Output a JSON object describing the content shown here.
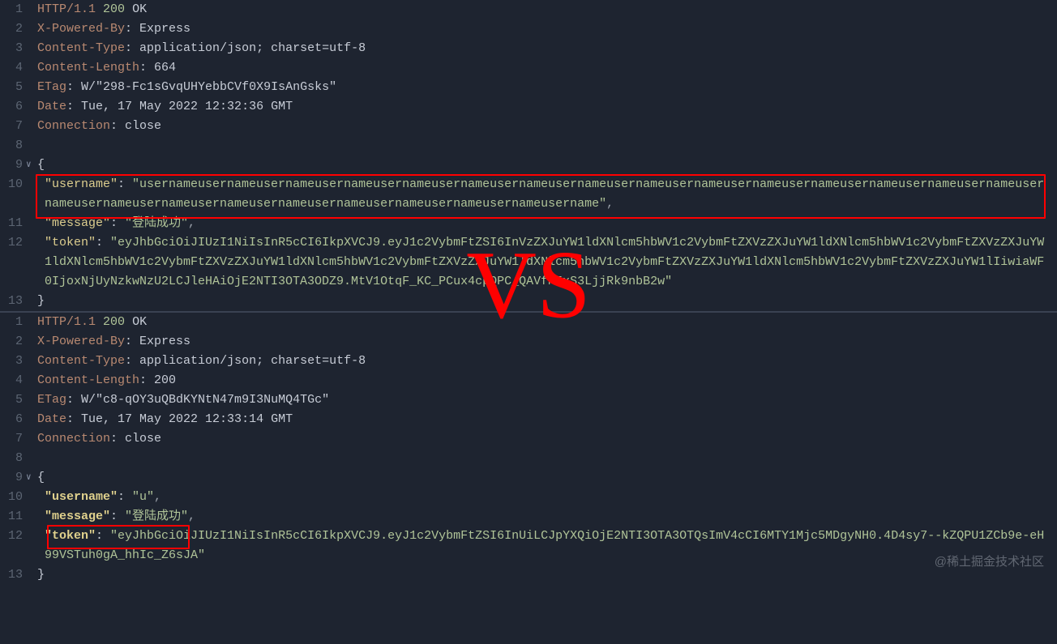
{
  "top": {
    "lines": [
      {
        "n": 1,
        "fold": "",
        "html": [
          [
            "hdr",
            "HTTP/1.1"
          ],
          [
            "sp",
            " "
          ],
          [
            "num",
            "200"
          ],
          [
            "sp",
            " "
          ],
          [
            "val",
            "OK"
          ]
        ]
      },
      {
        "n": 2,
        "fold": "",
        "html": [
          [
            "hdr",
            "X-Powered-By"
          ],
          [
            "colon",
            ": "
          ],
          [
            "val",
            "Express"
          ]
        ]
      },
      {
        "n": 3,
        "fold": "",
        "html": [
          [
            "hdr",
            "Content-Type"
          ],
          [
            "colon",
            ": "
          ],
          [
            "val",
            "application/json; charset=utf-8"
          ]
        ]
      },
      {
        "n": 4,
        "fold": "",
        "html": [
          [
            "hdr",
            "Content-Length"
          ],
          [
            "colon",
            ": "
          ],
          [
            "val",
            "664"
          ]
        ]
      },
      {
        "n": 5,
        "fold": "",
        "html": [
          [
            "hdr",
            "ETag"
          ],
          [
            "colon",
            ": "
          ],
          [
            "val",
            "W/\"298-Fc1sGvqUHYebbCVf0X9IsAnGsks\""
          ]
        ]
      },
      {
        "n": 6,
        "fold": "",
        "html": [
          [
            "hdr",
            "Date"
          ],
          [
            "colon",
            ": "
          ],
          [
            "val",
            "Tue, 17 May 2022 12:32:36 GMT"
          ]
        ]
      },
      {
        "n": 7,
        "fold": "",
        "html": [
          [
            "hdr",
            "Connection"
          ],
          [
            "colon",
            ": "
          ],
          [
            "val",
            "close"
          ]
        ]
      },
      {
        "n": 8,
        "fold": "",
        "html": [
          [
            "val",
            ""
          ]
        ]
      },
      {
        "n": 9,
        "fold": "v",
        "html": [
          [
            "punc",
            "{"
          ]
        ]
      },
      {
        "n": 10,
        "fold": "",
        "indent": 1,
        "html": [
          [
            "key",
            "\"username\""
          ],
          [
            "colon",
            ": "
          ],
          [
            "str",
            "\"usernameusernameusernameusernameusernameusernameusernameusernameusernameusernameusernameusernameusernameusernameusernameusernameusernameusernameusernameusernameusernameusernameusernameusernameusername\""
          ],
          [
            "punc2",
            ","
          ]
        ]
      },
      {
        "n": 11,
        "fold": "",
        "indent": 1,
        "html": [
          [
            "key",
            "\"message\""
          ],
          [
            "colon",
            ": "
          ],
          [
            "str",
            "\"登陆成功\""
          ],
          [
            "punc2",
            ","
          ]
        ]
      },
      {
        "n": 12,
        "fold": "",
        "indent": 1,
        "html": [
          [
            "key",
            "\"token\""
          ],
          [
            "colon",
            ": "
          ],
          [
            "str",
            "\"eyJhbGciOiJIUzI1NiIsInR5cCI6IkpXVCJ9.eyJ1c2VybmFtZSI6InVzZXJuYW1ldXNlcm5hbWV1c2VybmFtZXVzZXJuYW1ldXNlcm5hbWV1c2VybmFtZXVzZXJuYW1ldXNlcm5hbWV1c2VybmFtZXVzZXJuYW1ldXNlcm5hbWV1c2VybmFtZXVzZXJuYW1ldXNlcm5hbWV1c2VybmFtZXVzZXJuYW1ldXNlcm5hbWV1c2VybmFtZXVzZXJuYW1lIiwiaWF0IjoxNjUyNzkwNzU2LCJleHAiOjE2NTI3OTA3ODZ9.MtV1OtqF_KC_PCux4cpQPC_QAVfM5xS3LjjRk9nbB2w\""
          ]
        ]
      },
      {
        "n": 13,
        "fold": "",
        "html": [
          [
            "punc",
            "}"
          ]
        ]
      }
    ]
  },
  "bottom": {
    "lines": [
      {
        "n": 1,
        "fold": "",
        "html": [
          [
            "hdr",
            "HTTP/1.1"
          ],
          [
            "sp",
            " "
          ],
          [
            "num",
            "200"
          ],
          [
            "sp",
            " "
          ],
          [
            "val",
            "OK"
          ]
        ]
      },
      {
        "n": 2,
        "fold": "",
        "html": [
          [
            "hdr",
            "X-Powered-By"
          ],
          [
            "colon",
            ": "
          ],
          [
            "val",
            "Express"
          ]
        ]
      },
      {
        "n": 3,
        "fold": "",
        "html": [
          [
            "hdr",
            "Content-Type"
          ],
          [
            "colon",
            ": "
          ],
          [
            "val",
            "application/json; charset=utf-8"
          ]
        ]
      },
      {
        "n": 4,
        "fold": "",
        "html": [
          [
            "hdr",
            "Content-Length"
          ],
          [
            "colon",
            ": "
          ],
          [
            "val",
            "200"
          ]
        ]
      },
      {
        "n": 5,
        "fold": "",
        "html": [
          [
            "hdr",
            "ETag"
          ],
          [
            "colon",
            ": "
          ],
          [
            "val",
            "W/\"c8-qOY3uQBdKYNtN47m9I3NuMQ4TGc\""
          ]
        ]
      },
      {
        "n": 6,
        "fold": "",
        "html": [
          [
            "hdr",
            "Date"
          ],
          [
            "colon",
            ": "
          ],
          [
            "val",
            "Tue, 17 May 2022 12:33:14 GMT"
          ]
        ]
      },
      {
        "n": 7,
        "fold": "",
        "html": [
          [
            "hdr",
            "Connection"
          ],
          [
            "colon",
            ": "
          ],
          [
            "val",
            "close"
          ]
        ]
      },
      {
        "n": 8,
        "fold": "",
        "html": [
          [
            "val",
            ""
          ]
        ]
      },
      {
        "n": 9,
        "fold": "v",
        "html": [
          [
            "punc",
            "{"
          ]
        ]
      },
      {
        "n": 10,
        "fold": "",
        "indent": 1,
        "html": [
          [
            "key",
            "\"username\""
          ],
          [
            "colon",
            ": "
          ],
          [
            "str",
            "\"u\""
          ],
          [
            "punc2",
            ","
          ]
        ]
      },
      {
        "n": 11,
        "fold": "",
        "indent": 1,
        "html": [
          [
            "key",
            "\"message\""
          ],
          [
            "colon",
            ": "
          ],
          [
            "str",
            "\"登陆成功\""
          ],
          [
            "punc2",
            ","
          ]
        ]
      },
      {
        "n": 12,
        "fold": "",
        "indent": 1,
        "html": [
          [
            "key",
            "\"token\""
          ],
          [
            "colon",
            ": "
          ],
          [
            "str",
            "\"eyJhbGciOiJIUzI1NiIsInR5cCI6IkpXVCJ9.eyJ1c2VybmFtZSI6InUiLCJpYXQiOjE2NTI3OTA3OTQsImV4cCI6MTY1Mjc5MDgyNH0.4D4sy7--kZQPU1ZCb9e-eH99VSTuh0gA_hhIc_Z6sJA\""
          ]
        ]
      },
      {
        "n": 13,
        "fold": "",
        "html": [
          [
            "punc",
            "}"
          ]
        ]
      }
    ]
  },
  "overlay": {
    "vs": "VS",
    "watermark": "@稀土掘金技术社区"
  }
}
